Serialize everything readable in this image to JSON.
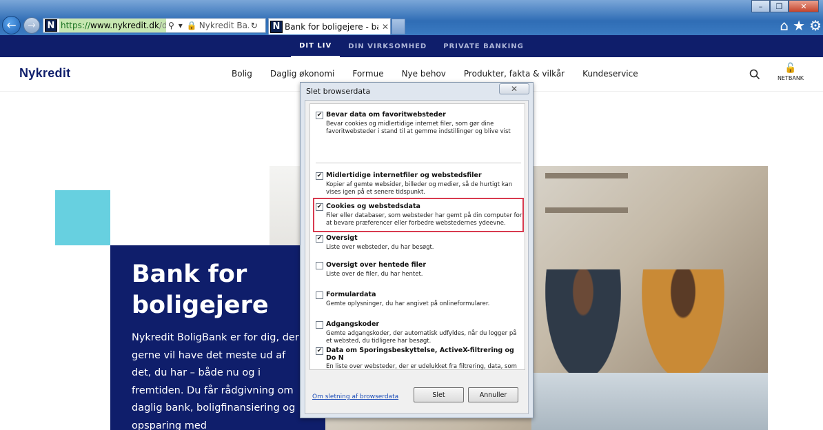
{
  "browser": {
    "url_scheme": "https://",
    "url_host": "www.nykredit.dk",
    "url_path": "/dit-liv/",
    "site_badge": "Nykredit Ba...",
    "tab_title": "Bank for boligejere - bank, ...",
    "favicon_letter": "N",
    "window_controls": [
      "–",
      "❐",
      "✕"
    ],
    "toolbar_icons": [
      "home-icon",
      "star-icon",
      "gear-icon"
    ]
  },
  "topnav": {
    "items": [
      "DIT LIV",
      "DIN VIRKSOMHED",
      "PRIVATE BANKING"
    ]
  },
  "header": {
    "logo": "Nykredit",
    "nav": [
      "Bolig",
      "Daglig økonomi",
      "Formue",
      "Nye behov",
      "Produkter, fakta & vilkår",
      "Kundeservice"
    ],
    "netbank": "NETBANK"
  },
  "hero": {
    "title": "Bank for boligejere",
    "text": "Nykredit BoligBank er for dig, der gerne vil have det meste ud af det, du har – både nu og i fremtiden. Du får rådgivning om daglig bank, boligfinansiering og opsparing med"
  },
  "dialog": {
    "title": "Slet browserdata",
    "options": [
      {
        "label": "Bevar data om favoritwebsteder",
        "desc": "Bevar cookies og midlertidige internet filer, som gør dine favoritwebsteder i stand til at gemme indstillinger og blive vist",
        "checked": true
      },
      {
        "label": "Midlertidige internetfiler og webstedsfiler",
        "desc": "Kopier af gemte websider, billeder og medier, så de hurtigt kan vises igen på et senere tidspunkt.",
        "checked": true
      },
      {
        "label": "Cookies og webstedsdata",
        "desc": "Filer eller databaser, som websteder har gemt på din computer for at bevare præferencer eller forbedre webstedernes ydeevne.",
        "checked": true
      },
      {
        "label": "Oversigt",
        "desc": "Liste over websteder, du har besøgt.",
        "checked": true
      },
      {
        "label": "Oversigt over hentede filer",
        "desc": "Liste over de filer, du har hentet.",
        "checked": false
      },
      {
        "label": "Formulardata",
        "desc": "Gemte oplysninger, du har angivet på onlineformularer.",
        "checked": false
      },
      {
        "label": "Adgangskoder",
        "desc": "Gemte adgangskoder, der automatisk udfyldes, når du logger på et websted, du tidligere har besøgt.",
        "checked": false
      },
      {
        "label": "Data om Sporingsbeskyttelse, ActiveX-filtrering og Do N",
        "desc": "En liste over websteder, der er udelukket fra filtrering, data, som bruges af Sporingsbeskyttelse til at registrere, hvor tjenester automatisk kan dele detaljer om dit besøg, og undtagelser til Do Not Track-anmodninger.",
        "checked": true
      }
    ],
    "link": "Om sletning af browserdata",
    "delete_button": "Slet",
    "cancel_button": "Annuller"
  }
}
